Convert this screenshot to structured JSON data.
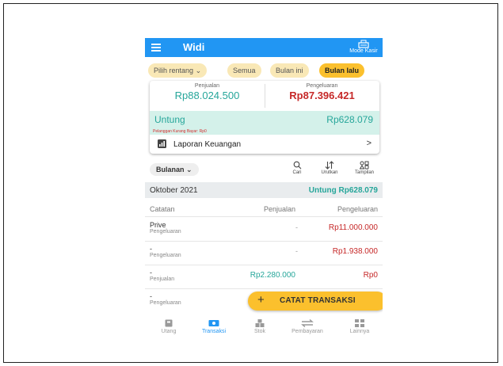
{
  "appbar": {
    "title": "Widi",
    "mode_kasir": "Mode Kasir"
  },
  "filters": [
    {
      "label": "Pilih rentang",
      "active": false
    },
    {
      "label": "Semua",
      "active": false
    },
    {
      "label": "Bulan ini",
      "active": false
    },
    {
      "label": "Bulan lalu",
      "active": true
    }
  ],
  "summary": {
    "penjualan_label": "Penjualan",
    "penjualan_value": "Rp88.024.500",
    "pengeluaran_label": "Pengeluaran",
    "pengeluaran_value": "Rp87.396.421",
    "untung_label": "Untung",
    "untung_value": "Rp628.079",
    "debt_note": "Pelanggan Kurang Bayar: Rp0",
    "report_label": "Laporan Keuangan",
    "report_chevron": ">"
  },
  "toolbar": {
    "period": "Bulanan",
    "cari": "Cari",
    "urutkan": "Urutkan",
    "tampilan": "Tampilan"
  },
  "month": {
    "label": "Oktober 2021",
    "total": "Untung Rp628.079"
  },
  "table": {
    "headers": [
      "Catatan",
      "Penjualan",
      "Pengeluaran"
    ],
    "rows": [
      {
        "title": "Prive",
        "type": "Pengeluaran",
        "penjualan": "-",
        "pengeluaran": "Rp11.000.000"
      },
      {
        "title": "-",
        "type": "Pengeluaran",
        "penjualan": "-",
        "pengeluaran": "Rp1.938.000"
      },
      {
        "title": "-",
        "type": "Penjualan",
        "penjualan": "Rp2.280.000",
        "pengeluaran": "Rp0"
      },
      {
        "title": "-",
        "type": "Pengeluaran",
        "penjualan": "",
        "pengeluaran": ""
      }
    ]
  },
  "fab": {
    "plus": "+",
    "label": "CATAT TRANSAKSI"
  },
  "bottom_nav": [
    {
      "label": "Utang",
      "icon": "ledger-icon",
      "active": false
    },
    {
      "label": "Transaksi",
      "icon": "money-icon",
      "active": true
    },
    {
      "label": "Stok",
      "icon": "boxes-icon",
      "active": false
    },
    {
      "label": "Pembayaran",
      "icon": "transfer-icon",
      "active": false
    },
    {
      "label": "Lainnya",
      "icon": "grid-icon",
      "active": false
    }
  ],
  "colors": {
    "primary": "#2196f3",
    "accent": "#fbc02d",
    "income": "#26a69a",
    "expense": "#c62828"
  }
}
